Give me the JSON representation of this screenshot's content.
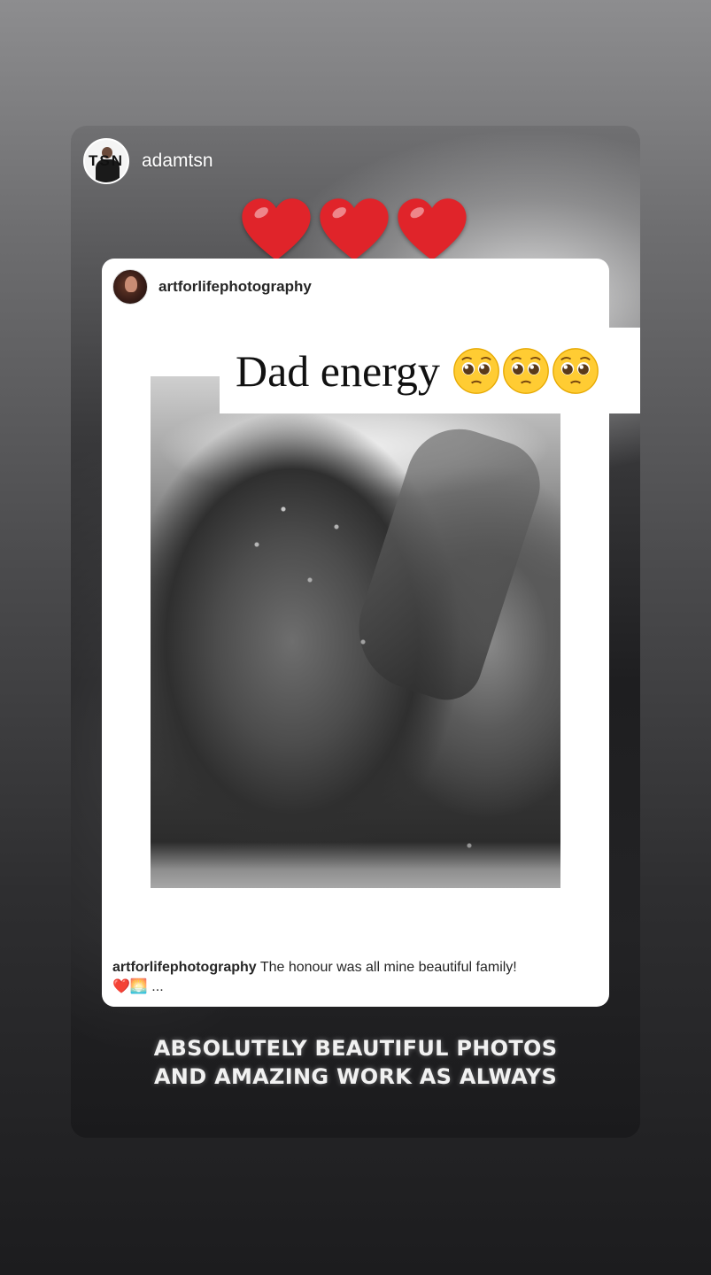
{
  "story": {
    "author": "adamtsn",
    "author_avatar_logo": "TSN",
    "hearts": [
      "red-heart",
      "red-heart",
      "red-heart"
    ],
    "shared_post": {
      "username": "artforlifephotography",
      "caption_user": "artforlifephotography",
      "caption_text": "The honour was all mine beautiful family!",
      "caption_emojis": "❤️🌅",
      "caption_more": "..."
    },
    "sticker": {
      "text": "Dad energy",
      "emoji": "pleading-face",
      "emoji_count": 3
    },
    "overlay_text": {
      "line1": "ABSOLUTELY BEAUTIFUL PHOTOS",
      "line2": "AND AMAZING WORK AS ALWAYS"
    }
  },
  "colors": {
    "heart": "#e0242a",
    "emoji_face": "#ffcc33",
    "overlay_text": "#f1f1f1"
  }
}
